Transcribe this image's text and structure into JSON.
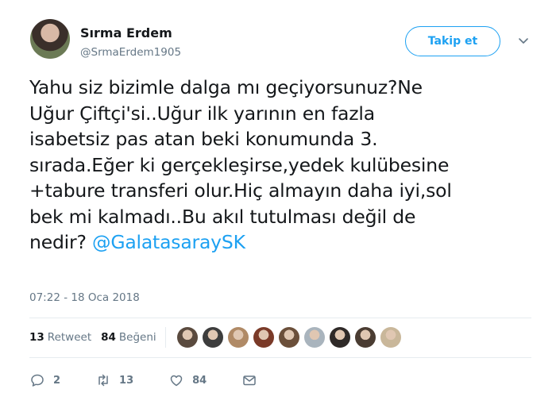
{
  "author": {
    "name": "Sırma Erdem",
    "handle": "@SrmaErdem1905"
  },
  "follow_label": "Takip et",
  "tweet": {
    "lines": [
      "Yahu siz bizimle dalga mı geçiyorsunuz?Ne",
      "Uğur Çiftçi'si..Uğur ilk yarının en fazla",
      "isabetsiz pas atan beki konumunda 3.",
      "sırada.Eğer ki gerçekleşirse,yedek kulübesine",
      "+tabure transferi olur.Hiç almayın daha iyi,sol",
      "bek mi kalmadı..Bu akıl tutulması değil de"
    ],
    "last_line_text": "nedir? ",
    "mention": "@GalatasaraySK"
  },
  "timestamp": "07:22 - 18 Oca 2018",
  "stats": {
    "retweet_count": "13",
    "retweet_label": "Retweet",
    "like_count": "84",
    "like_label": "Beğeni"
  },
  "likers": [
    {
      "icon": "avatar",
      "color": "#5a4a3e"
    },
    {
      "icon": "avatar",
      "color": "#3d3d3d"
    },
    {
      "icon": "avatar",
      "color": "#b08a66"
    },
    {
      "icon": "avatar",
      "color": "#7a3a28"
    },
    {
      "icon": "avatar",
      "color": "#6b4f3a"
    },
    {
      "icon": "avatar",
      "color": "#a9b4bd"
    },
    {
      "icon": "avatar",
      "color": "#2f2a28"
    },
    {
      "icon": "avatar",
      "color": "#4a3c32"
    },
    {
      "icon": "avatar",
      "color": "#c9b79a"
    }
  ],
  "actions": {
    "reply_count": "2",
    "retweet_count": "13",
    "like_count": "84"
  },
  "colors": {
    "accent": "#1da1f2",
    "muted": "#657786",
    "text": "#14171a",
    "divider": "#e6ecf0"
  }
}
